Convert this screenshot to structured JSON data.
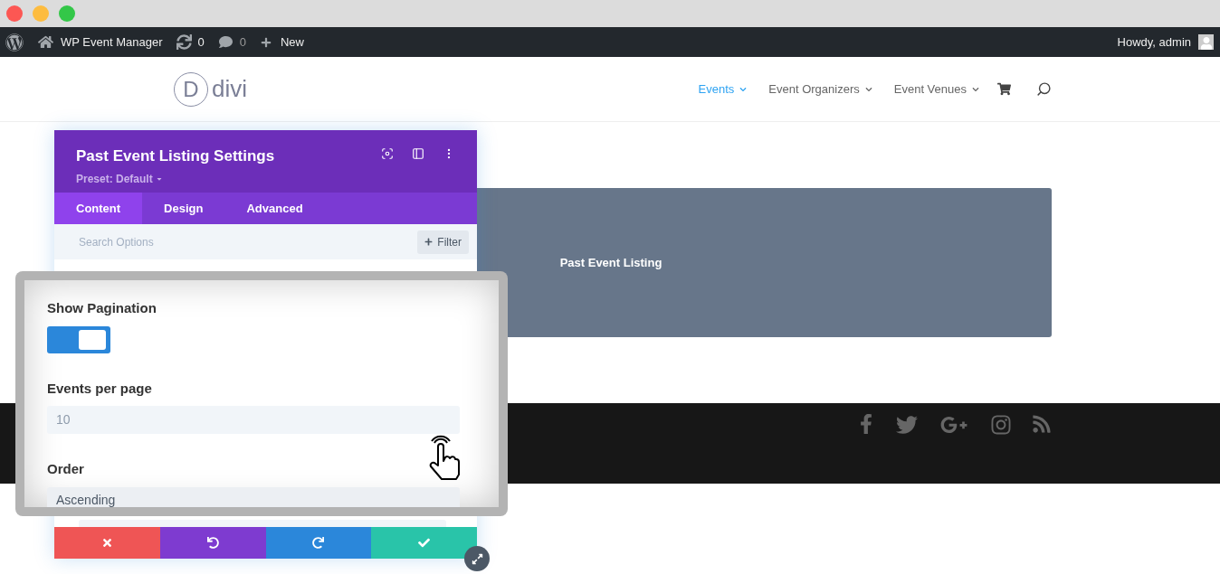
{
  "admin_bar": {
    "site": "WP Event Manager",
    "updates": "0",
    "comments": "0",
    "new": "New",
    "greeting": "Howdy, admin"
  },
  "header": {
    "logo_mark": "D",
    "logo_text": "divi",
    "nav": [
      {
        "label": "Events",
        "selected": true
      },
      {
        "label": "Event Organizers",
        "selected": false
      },
      {
        "label": "Event Venues",
        "selected": false
      }
    ]
  },
  "module": {
    "title": "Past Event Listing"
  },
  "panel": {
    "title": "Past Event Listing Settings",
    "preset": "Preset: Default",
    "tabs": [
      {
        "label": "Content",
        "selected": true
      },
      {
        "label": "Design",
        "selected": false
      },
      {
        "label": "Advanced",
        "selected": false
      }
    ],
    "search": {
      "placeholder": "Search Options"
    },
    "filter": "Filter"
  },
  "magnifier": {
    "fields": [
      {
        "kind": "toggle",
        "label": "Show Pagination",
        "on": true
      },
      {
        "kind": "input",
        "label": "Events per page",
        "value": "10"
      },
      {
        "kind": "select",
        "label": "Order",
        "value": "Ascending"
      }
    ]
  }
}
